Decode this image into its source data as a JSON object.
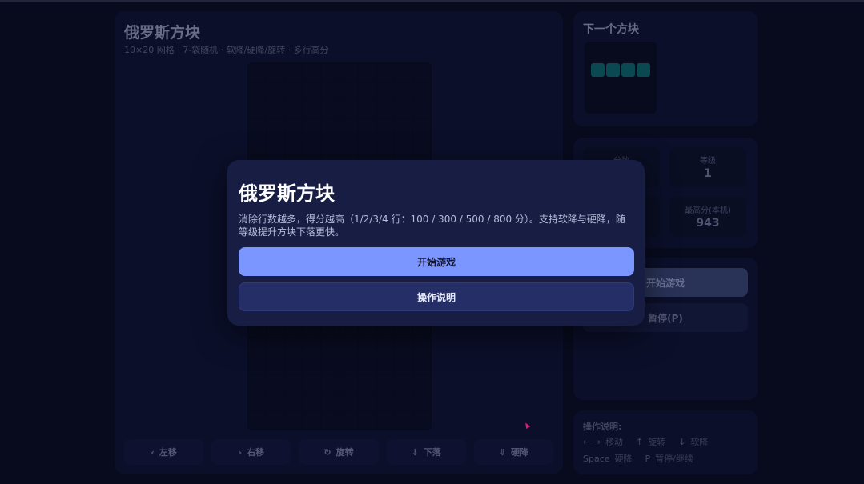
{
  "game": {
    "title": "俄罗斯方块",
    "subtitle": "10×20 网格 · 7-袋随机 · 软降/硬降/旋转 · 多行高分",
    "controls": [
      {
        "icon": "‹",
        "label": "左移"
      },
      {
        "icon": "›",
        "label": "右移"
      },
      {
        "icon": "↻",
        "label": "旋转"
      },
      {
        "icon": "↓",
        "label": "下落"
      },
      {
        "icon": "⇓",
        "label": "硬降"
      }
    ]
  },
  "next": {
    "title": "下一个方块",
    "piece_color": "#0e5f67"
  },
  "stats": {
    "score_label": "分数",
    "score_value": "",
    "level_label": "等级",
    "level_value": "1",
    "lines_label": "",
    "lines_value": "",
    "best_label": "最高分(本机)",
    "best_value": "943"
  },
  "actions": {
    "start": "开始游戏",
    "pause": "暂停(P)"
  },
  "help": {
    "title": "操作说明:",
    "rows": [
      [
        {
          "key": "← →",
          "desc": "移动"
        },
        {
          "key": "↑",
          "desc": "旋转"
        },
        {
          "key": "↓",
          "desc": "软降"
        }
      ],
      [
        {
          "key": "Space",
          "desc": "硬降"
        },
        {
          "key": "P",
          "desc": "暂停/继续"
        }
      ]
    ]
  },
  "modal": {
    "title": "俄罗斯方块",
    "description": "消除行数越多，得分越高（1/2/3/4 行：100 / 300 / 500 / 800 分）。支持软降与硬降，随等级提升方块下落更快。",
    "primary_button": "开始游戏",
    "secondary_button": "操作说明"
  },
  "colors": {
    "accent": "#7b96ff",
    "background": "#0a0d22",
    "panel": "#0e1230"
  }
}
